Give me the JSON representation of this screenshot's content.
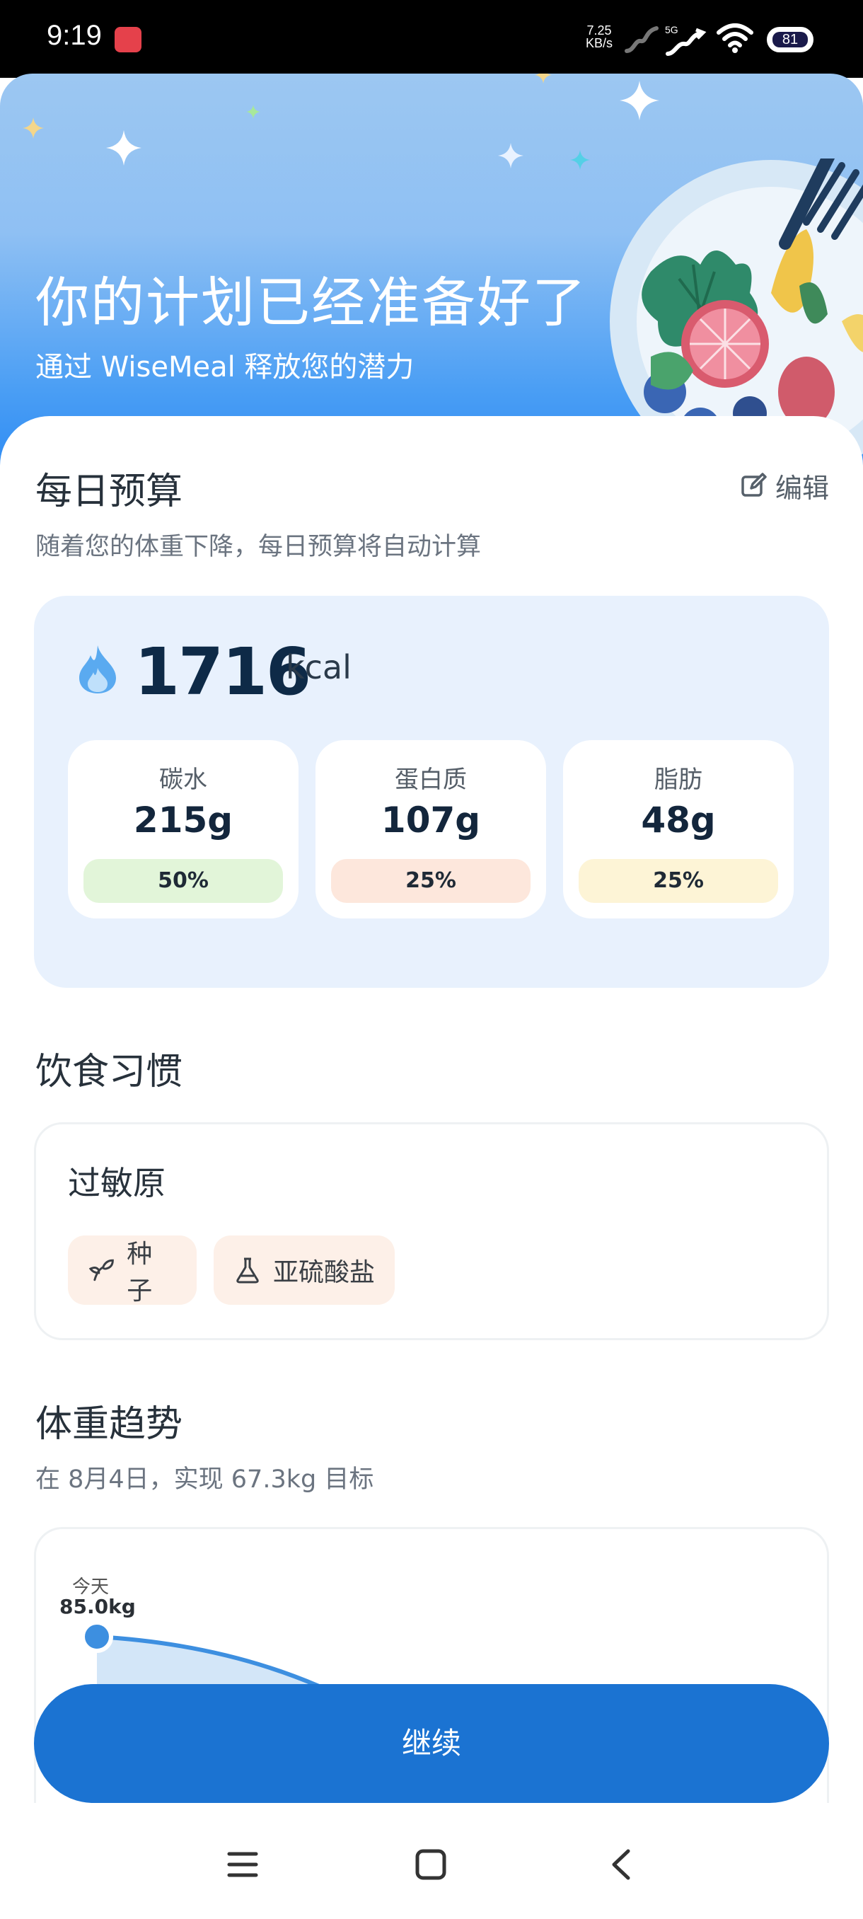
{
  "status": {
    "time": "9:19",
    "net_speed_value": "7.25",
    "net_speed_unit": "KB/s",
    "network": "5G",
    "battery": "81"
  },
  "hero": {
    "title": "你的计划已经准备好了",
    "subtitle": "通过 WiseMeal 释放您的潜力"
  },
  "budget": {
    "title": "每日预算",
    "edit_label": "编辑",
    "description": "随着您的体重下降，每日预算将自动计算",
    "kcal_value": "1716",
    "kcal_unit": "kcal",
    "macros": [
      {
        "label": "碳水",
        "value": "215g",
        "percent": "50%",
        "color": "#e2f5d9"
      },
      {
        "label": "蛋白质",
        "value": "107g",
        "percent": "25%",
        "color": "#fde7dc"
      },
      {
        "label": "脂肪",
        "value": "48g",
        "percent": "25%",
        "color": "#fdf4d6"
      }
    ]
  },
  "habits": {
    "title": "饮食习惯",
    "allergen_title": "过敏原",
    "chips": [
      {
        "label": "种子",
        "icon": "sprout-icon"
      },
      {
        "label": "亚硫酸盐",
        "icon": "flask-icon"
      }
    ]
  },
  "trend": {
    "title": "体重趋势",
    "subtitle": "在 8月4日，实现 67.3kg 目标",
    "today_label": "今天",
    "today_value": "85.0kg"
  },
  "continue_label": "继续",
  "colors": {
    "accent": "#1b73d2",
    "budget_card_bg": "#e8f1fd",
    "chip_bg": "#fdf0e8"
  }
}
